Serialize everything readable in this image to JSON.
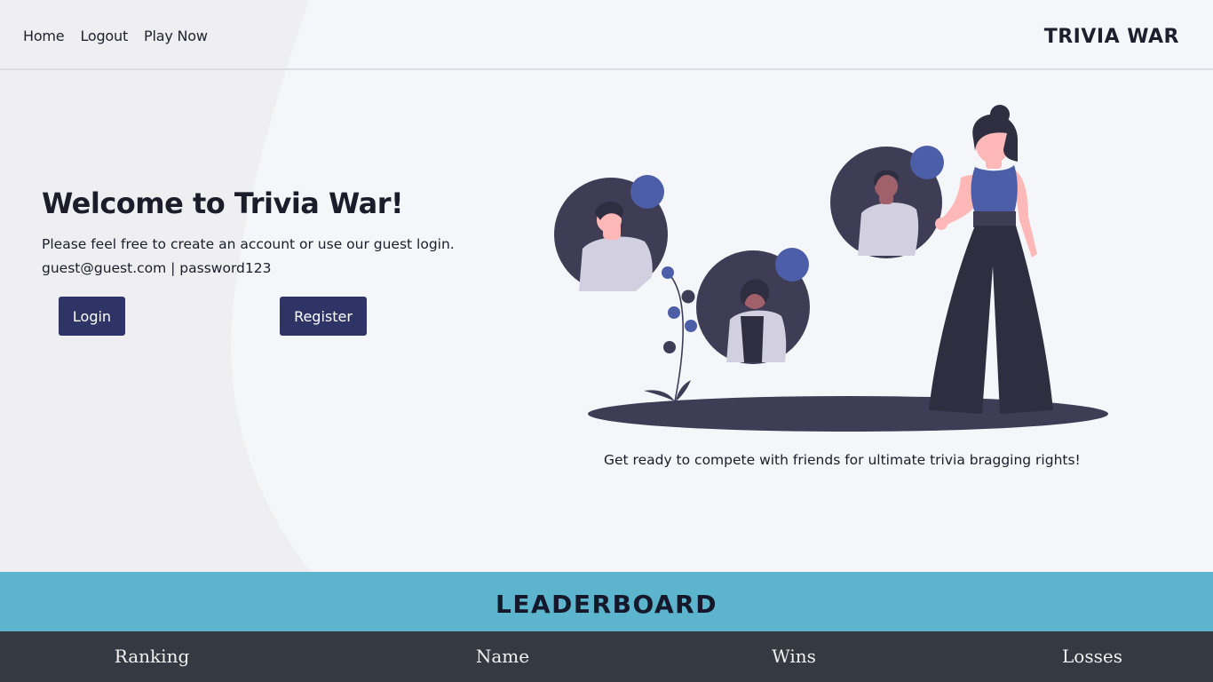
{
  "nav": {
    "links": [
      {
        "label": "Home"
      },
      {
        "label": "Logout"
      },
      {
        "label": "Play Now"
      }
    ],
    "brand": "TRIVIA WAR"
  },
  "hero": {
    "title": "Welcome to Trivia War!",
    "line1": "Please feel free to create an account or use our guest login.",
    "line2": "guest@guest.com | password123",
    "login_label": "Login",
    "register_label": "Register",
    "tagline": "Get ready to compete with friends for ultimate trivia bragging rights!"
  },
  "leaderboard": {
    "title": "LEADERBOARD",
    "columns": [
      "Ranking",
      "Name",
      "Wins",
      "Losses"
    ]
  },
  "colors": {
    "background": "#f5f6fa",
    "curve_shape": "#efeff1",
    "button": "#2e3566",
    "leaderboard_band": "#5cb4cd",
    "table_header": "#353942",
    "accent_blue": "#4c5ea8",
    "dark_figure": "#3f3d56"
  },
  "illustration": {
    "name": "friends-connecting-illustration"
  }
}
